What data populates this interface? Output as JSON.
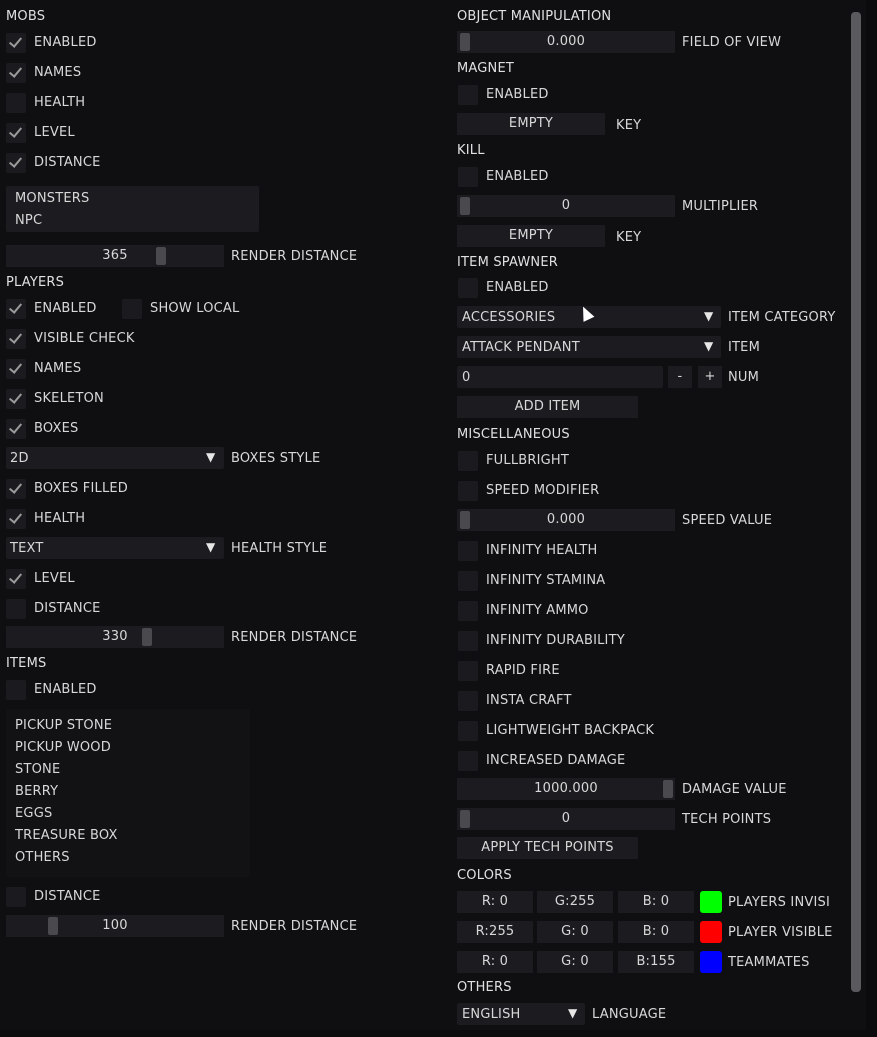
{
  "mobs": {
    "header": "MOBS",
    "enabled": "ENABLED",
    "names": "NAMES",
    "health": "HEALTH",
    "level": "LEVEL",
    "distance": "DISTANCE",
    "list": [
      "MONSTERS",
      "NPC"
    ],
    "render_value": "365",
    "render_label": "RENDER DISTANCE"
  },
  "players": {
    "header": "PLAYERS",
    "enabled": "ENABLED",
    "show_local": "SHOW LOCAL",
    "visible_check": "VISIBLE CHECK",
    "names": "NAMES",
    "skeleton": "SKELETON",
    "boxes": "BOXES",
    "boxes_style_value": "2D",
    "boxes_style_label": "BOXES STYLE",
    "boxes_filled": "BOXES FILLED",
    "health": "HEALTH",
    "health_style_value": "TEXT",
    "health_style_label": "HEALTH STYLE",
    "level": "LEVEL",
    "distance": "DISTANCE",
    "render_value": "330",
    "render_label": "RENDER DISTANCE"
  },
  "items": {
    "header": "ITEMS",
    "enabled": "ENABLED",
    "list": [
      "PICKUP STONE",
      "PICKUP WOOD",
      "STONE",
      "BERRY",
      "EGGS",
      "TREASURE BOX",
      "OTHERS"
    ],
    "distance": "DISTANCE",
    "render_value": "100",
    "render_label": "RENDER DISTANCE"
  },
  "objman": {
    "header": "OBJECT MANIPULATION",
    "fov_value": "0.000",
    "fov_label": "FIELD OF VIEW"
  },
  "magnet": {
    "header": "MAGNET",
    "enabled": "ENABLED",
    "key_value": "EMPTY",
    "key_label": "KEY"
  },
  "kill": {
    "header": "KILL",
    "enabled": "ENABLED",
    "mult_value": "0",
    "mult_label": "MULTIPLIER",
    "key_value": "EMPTY",
    "key_label": "KEY"
  },
  "spawner": {
    "header": "ITEM SPAWNER",
    "enabled": "ENABLED",
    "category_value": "ACCESSORIES",
    "category_label": "ITEM CATEGORY",
    "item_value": "ATTACK PENDANT",
    "item_label": "ITEM",
    "num_value": "0",
    "minus": "-",
    "plus": "+",
    "num_label": "NUM",
    "add_item": "ADD ITEM"
  },
  "misc": {
    "header": "MISCELLANEOUS",
    "fullbright": "FULLBRIGHT",
    "speed_mod": "SPEED MODIFIER",
    "speed_value": "0.000",
    "speed_label": "SPEED VALUE",
    "inf_health": "INFINITY HEALTH",
    "inf_stamina": "INFINITY STAMINA",
    "inf_ammo": "INFINITY AMMO",
    "inf_durability": "INFINITY DURABILITY",
    "rapid_fire": "RAPID FIRE",
    "insta_craft": "INSTA CRAFT",
    "lightweight": "LIGHTWEIGHT BACKPACK",
    "inc_damage": "INCREASED DAMAGE",
    "damage_value": "1000.000",
    "damage_label": "DAMAGE VALUE",
    "tech_value": "0",
    "tech_label": "TECH POINTS",
    "apply_tech": "APPLY TECH POINTS"
  },
  "colors": {
    "header": "COLORS",
    "rows": [
      {
        "r": "R:  0",
        "g": "G:255",
        "b": "B:  0",
        "swatch": "#00ff00",
        "label": "PLAYERS INVISI"
      },
      {
        "r": "R:255",
        "g": "G:  0",
        "b": "B:  0",
        "swatch": "#ff0000",
        "label": "PLAYER VISIBLE"
      },
      {
        "r": "R:  0",
        "g": "G:  0",
        "b": "B:155",
        "swatch": "#0000ff",
        "label": "TEAMMATES"
      }
    ]
  },
  "others": {
    "header": "OTHERS",
    "language_value": "ENGLISH",
    "language_label": "LANGUAGE"
  }
}
